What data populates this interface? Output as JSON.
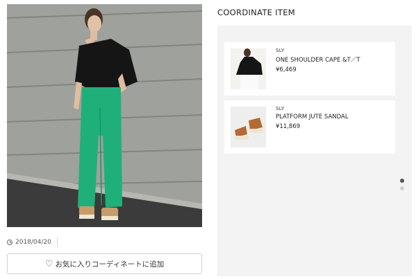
{
  "post": {
    "date": "2018/04/20",
    "favorite_label": "お気に入りコーディネートに追加"
  },
  "colors": {
    "pants": "#1fb07a",
    "top": "#151515",
    "wall": "#8f918c"
  },
  "coordinate": {
    "title": "COORDINATE ITEM",
    "items": [
      {
        "brand": "SLY",
        "name": "ONE SHOULDER CAPE &T／T",
        "price": "¥6,469",
        "thumb_icon": "black-one-shoulder-top"
      },
      {
        "brand": "SLY",
        "name": "PLATFORM JUTE SANDAL",
        "price": "¥11,869",
        "thumb_icon": "brown-platform-sandal"
      }
    ],
    "pager": {
      "count": 2,
      "active": 1
    }
  }
}
